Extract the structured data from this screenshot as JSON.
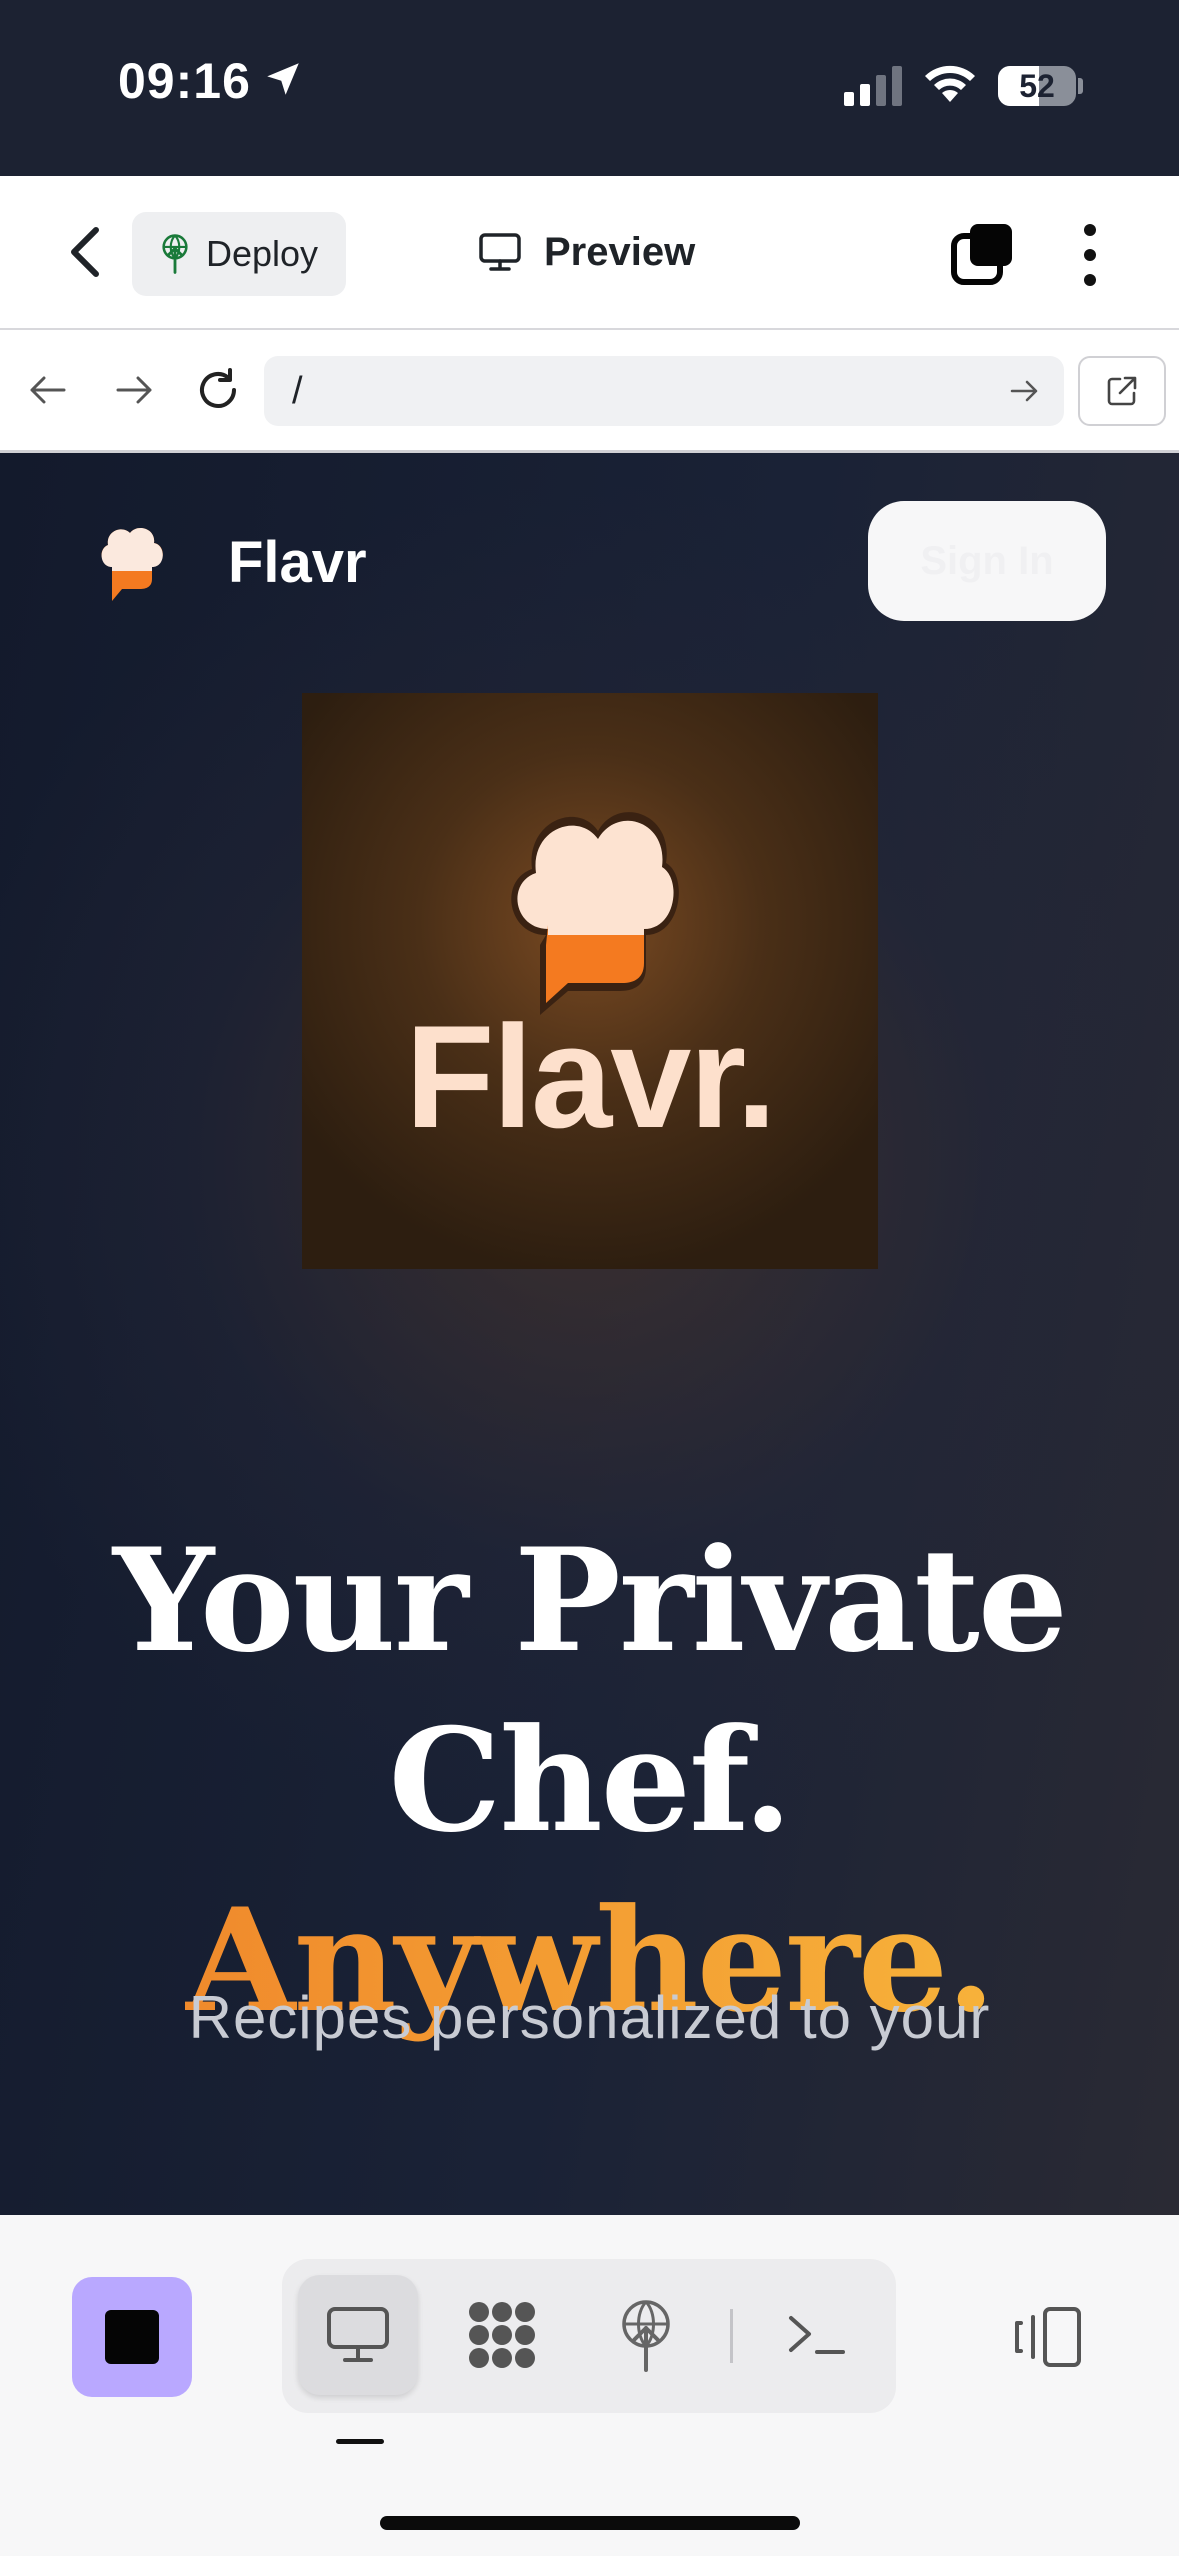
{
  "status_bar": {
    "time": "09:16",
    "battery": "52",
    "icons": [
      "location-arrow-icon",
      "cellular-signal-icon",
      "wifi-icon",
      "battery-icon"
    ]
  },
  "header": {
    "deploy_label": "Deploy",
    "title": "Preview"
  },
  "url_bar": {
    "value": "/"
  },
  "site": {
    "name": "Flavr",
    "sign_in_label": "Sign In",
    "hero_brand": "Flavr.",
    "headline_line1": "Your Private",
    "headline_line2": "Chef.",
    "headline_accent": "Anywhere.",
    "subtext": "Recipes personalized to your"
  },
  "toolbar": {
    "modes": [
      "preview-monitor-icon",
      "apps-grid-icon",
      "deploy-icon",
      "terminal-icon"
    ],
    "active_mode": "preview-monitor-icon"
  },
  "colors": {
    "status_bg": "#1c2232",
    "accent_purple": "#b9a8ff",
    "accent_orange": "#f08a2c",
    "accent_gold": "#f7b23a",
    "hero_text": "#fde0cc"
  }
}
